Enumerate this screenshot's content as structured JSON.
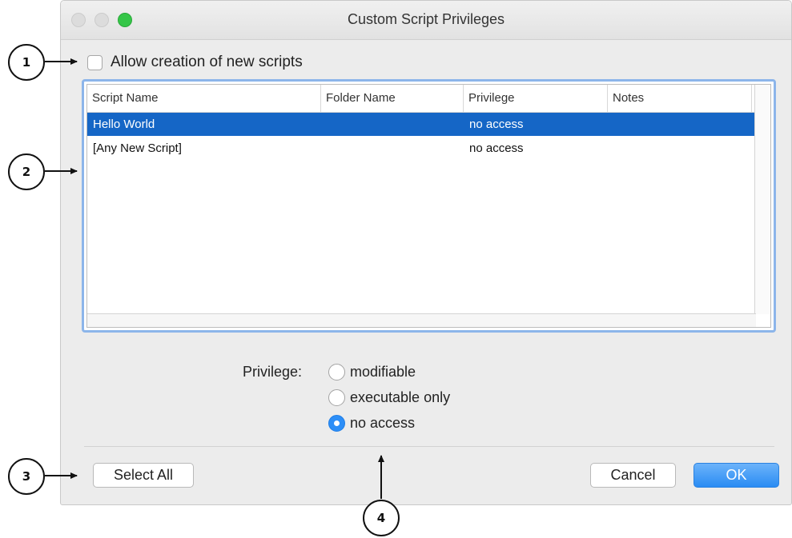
{
  "window": {
    "title": "Custom Script Privileges",
    "traffic_lights": [
      "close",
      "minimize",
      "zoom"
    ]
  },
  "allow": {
    "label": "Allow creation of new scripts",
    "checked": false
  },
  "table": {
    "columns": [
      "Script Name",
      "Folder Name",
      "Privilege",
      "Notes"
    ],
    "rows": [
      {
        "script_name": "Hello World",
        "folder_name": "",
        "privilege": "no access",
        "notes": "",
        "selected": true
      },
      {
        "script_name": "[Any New Script]",
        "folder_name": "",
        "privilege": "no access",
        "notes": "",
        "selected": false
      }
    ]
  },
  "privilege": {
    "label": "Privilege:",
    "options": [
      "modifiable",
      "executable only",
      "no access"
    ],
    "selected": "no access"
  },
  "buttons": {
    "select_all": "Select All",
    "cancel": "Cancel",
    "ok": "OK"
  },
  "callouts": [
    "1",
    "2",
    "3",
    "4"
  ],
  "colors": {
    "selection": "#1566c6",
    "focus_ring": "#8cb5ea",
    "default_button": "#2a8cf3",
    "zoom_light": "#35c648"
  }
}
